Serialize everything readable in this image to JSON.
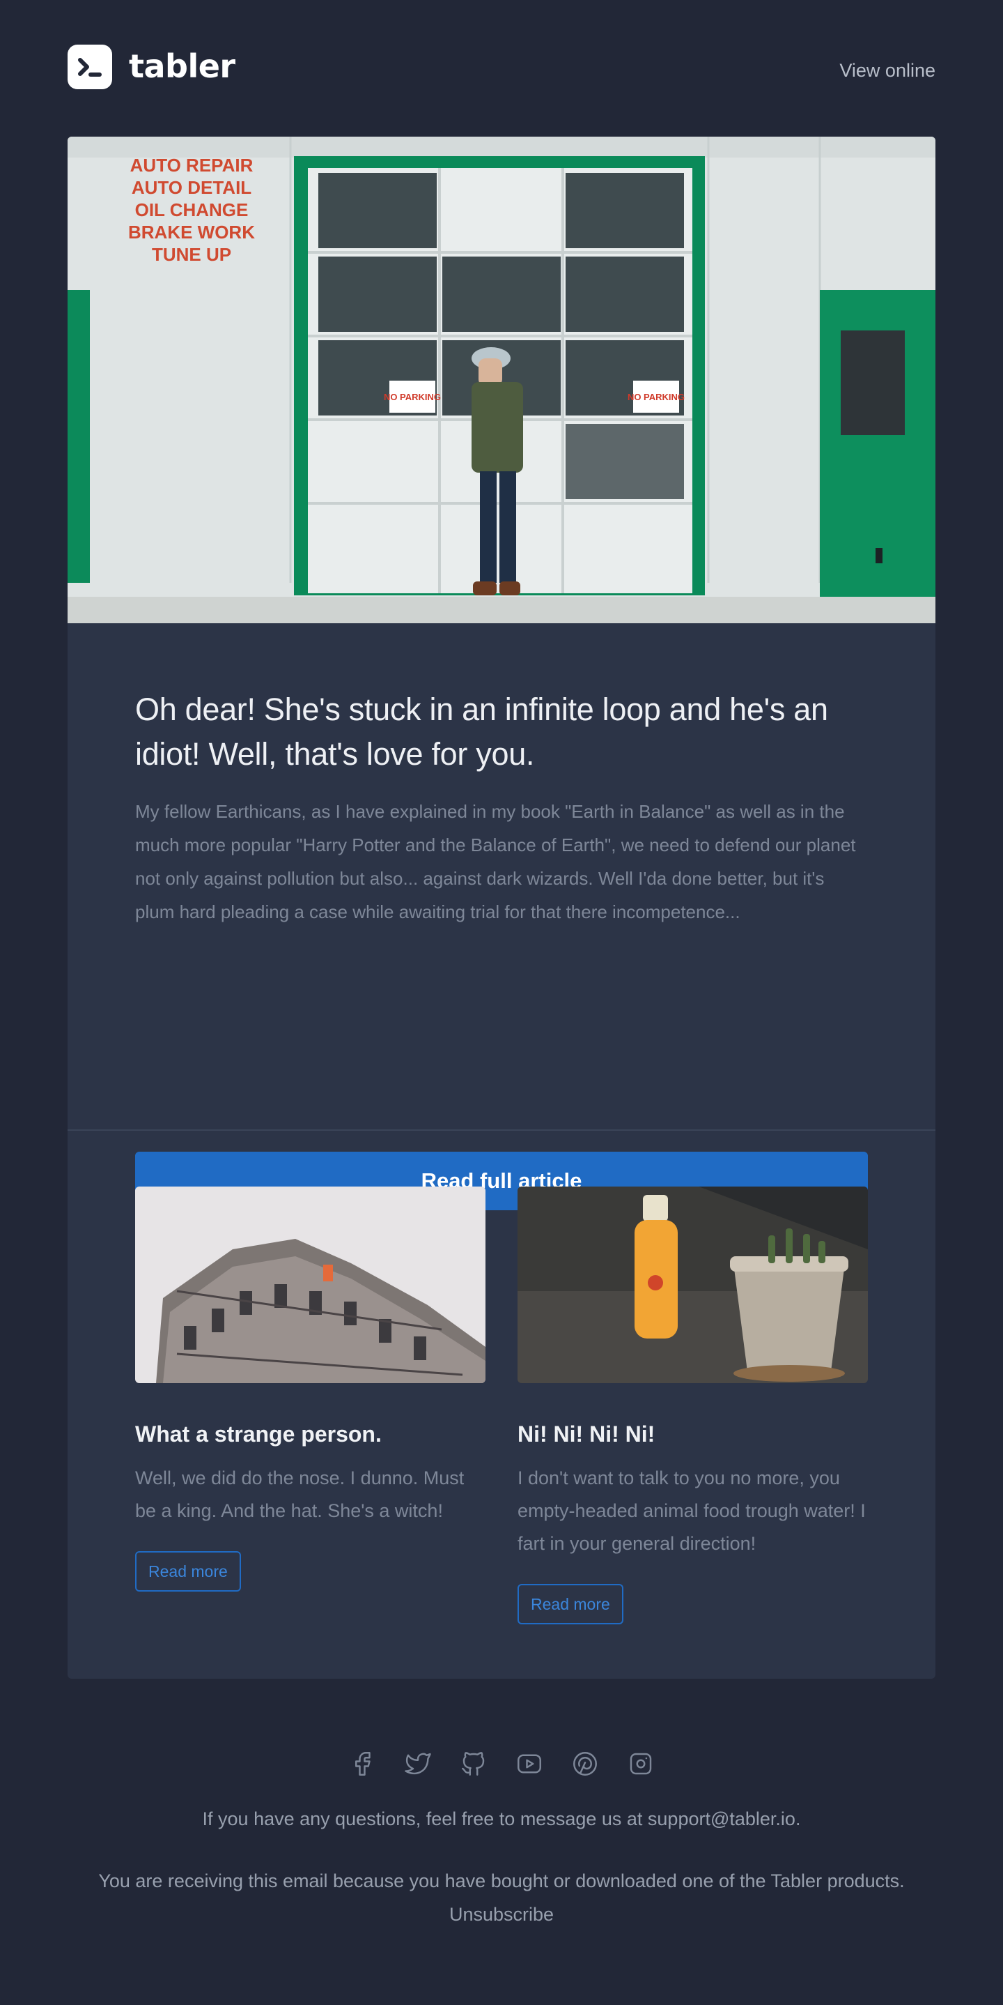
{
  "header": {
    "brand": "tabler",
    "view_online": "View online"
  },
  "hero": {
    "sign_lines": [
      "AUTO REPAIR",
      "AUTO DETAIL",
      "OIL CHANGE",
      "BRAKE WORK",
      "TUNE UP"
    ],
    "parking_sign": "NO PARKING"
  },
  "article": {
    "title": "Oh dear! She's stuck in an infinite loop and he's an idiot! Well, that's love for you.",
    "excerpt": "My fellow Earthicans, as I have explained in my book \"Earth in Balance\" as well as in the much more popular \"Harry Potter and the Balance of Earth\", we need to defend our planet not only against pollution but also... against dark wizards. Well I'da done better, but it's plum hard pleading a case while awaiting trial for that there incompetence...",
    "cta": "Read full article"
  },
  "columns": [
    {
      "title": "What a strange person.",
      "text": "Well, we did do the nose. I dunno. Must be a king. And the hat. She's a witch!",
      "button": "Read more"
    },
    {
      "title": "Ni! Ni! Ni! Ni!",
      "text": "I don't want to talk to you no more, you empty-headed animal food trough water! I fart in your general direction!",
      "button": "Read more"
    }
  ],
  "footer": {
    "social_icons": [
      "facebook-icon",
      "twitter-icon",
      "github-icon",
      "youtube-icon",
      "pinterest-icon",
      "instagram-icon"
    ],
    "question_text": "If you have any questions, feel free to message us at support@tabler.io.",
    "receiving_text": "You are receiving this email because you have bought or downloaded one of the Tabler products.",
    "unsubscribe": "Unsubscribe"
  },
  "colors": {
    "background": "#222737",
    "card": "#2c3447",
    "primary": "#206bc4"
  }
}
